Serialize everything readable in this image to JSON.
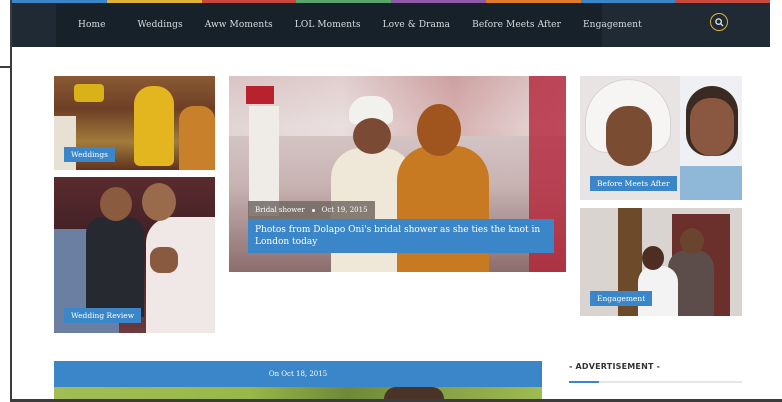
{
  "nav": {
    "items": [
      "Home",
      "Weddings",
      "Aww Moments",
      "LOL Moments",
      "Love & Drama",
      "Before Meets After",
      "Engagement"
    ],
    "stripe_colors": [
      "#3a86c8",
      "#e0b23a",
      "#c8463a",
      "#5aa36a",
      "#8e5aa8",
      "#e07a2a",
      "#3a86c8",
      "#c8463a"
    ]
  },
  "search": {
    "icon": "search-icon"
  },
  "tiles": {
    "weddings": {
      "label": "Weddings"
    },
    "wedding_review": {
      "label": "Wedding Review"
    },
    "feature": {
      "category": "Bridal shower",
      "date": "Oct 19, 2015",
      "title": "Photos from Dolapo Oni's bridal shower as she ties the knot in London today"
    },
    "before_after": {
      "label": "Before Meets After"
    },
    "engagement": {
      "label": "Engagement"
    }
  },
  "article": {
    "date": "On Oct 18, 2015"
  },
  "sidebar": {
    "ad_heading": "- ADVERTISEMENT -"
  },
  "colors": {
    "accent": "#3a86c8",
    "nav_bg": "#1f2a34",
    "search_ring": "#e0b23a"
  }
}
